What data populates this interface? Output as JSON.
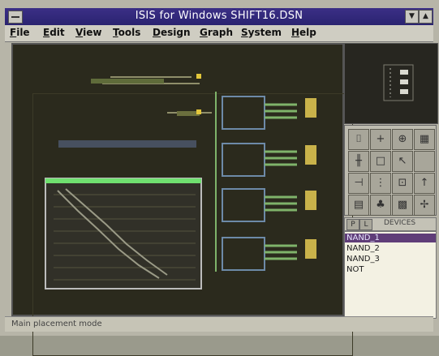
{
  "window": {
    "title": "ISIS for Windows  SHIFT16.DSN"
  },
  "menubar": {
    "items": [
      "File",
      "Edit",
      "View",
      "Tools",
      "Design",
      "Graph",
      "System",
      "Help"
    ]
  },
  "device_selector": {
    "buttons": [
      "P",
      "L"
    ],
    "header": "DEVICES"
  },
  "devices": {
    "items": [
      "NAND_1",
      "NAND_2",
      "NAND_3",
      "NOT"
    ],
    "selected_index": 0
  },
  "statusbar": {
    "text": "Main placement mode"
  },
  "colors": {
    "title_bg": "#2a2370",
    "canvas_bg": "#2b2a1d",
    "wire": "#7fb36a",
    "selection": "#5f3d78",
    "graph_border": "#6fe06f"
  }
}
